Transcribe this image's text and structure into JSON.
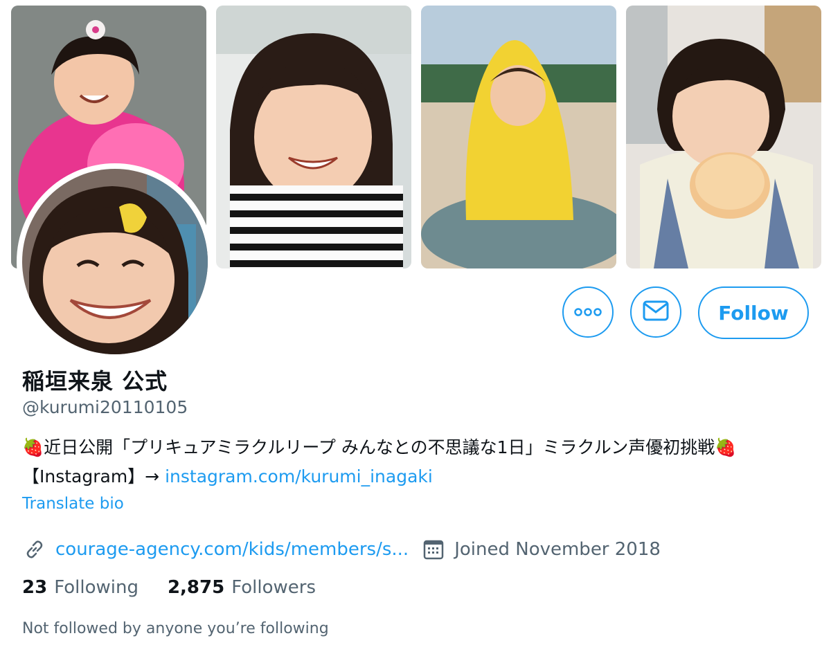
{
  "profile": {
    "name": "稲垣来泉 公式",
    "handle": "@kurumi20110105",
    "bio_text": "🍓近日公開「プリキュアミラクルリープ みんなとの不思議な1日」ミラクルン声優初挑戦🍓【Instagram】→ ",
    "bio_link": "instagram.com/kurumi_inagaki",
    "translate_label": "Translate bio",
    "website": "courage-agency.com/kids/members/s...",
    "joined": "Joined November 2018"
  },
  "actions": {
    "more_icon": "more-icon",
    "message_icon": "envelope-icon",
    "follow_label": "Follow"
  },
  "stats": {
    "following_count": "23",
    "following_label": "Following",
    "followers_count": "2,875",
    "followers_label": "Followers"
  },
  "social_context": "Not followed by anyone you’re following",
  "colors": {
    "accent": "#1d9bf0",
    "text_primary": "#0f1419",
    "text_secondary": "#536471"
  }
}
